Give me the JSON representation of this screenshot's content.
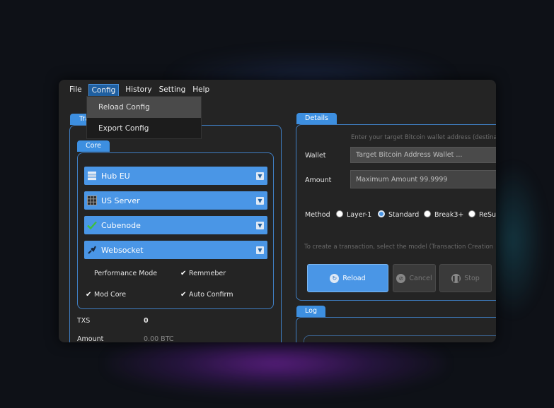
{
  "menubar": {
    "items": [
      "File",
      "Config",
      "History",
      "Setting",
      "Help"
    ],
    "active_index": 1
  },
  "config_menu": {
    "items": [
      "Reload Config",
      "Export Config"
    ],
    "hover_index": 0
  },
  "left_panel": {
    "tab_label": "Tra",
    "core": {
      "tab_label": "Core",
      "selects": [
        {
          "label": "Hub EU",
          "icon": "server-stack-icon"
        },
        {
          "label": "US Server",
          "icon": "server-grid-icon"
        },
        {
          "label": "Cubenode",
          "icon": "checkmark-icon"
        },
        {
          "label": "Websocket",
          "icon": "plug-icon"
        }
      ],
      "options": [
        {
          "label": "Performance Mode",
          "checked": false
        },
        {
          "label": "Remmeber",
          "checked": true
        },
        {
          "label": "Mod Core",
          "checked": true
        },
        {
          "label": "Auto Confirm",
          "checked": true
        }
      ]
    },
    "stats": {
      "txs_label": "TXS",
      "txs_value": "0",
      "amount_label": "Amount",
      "amount_value": "0.00 BTC"
    }
  },
  "details": {
    "tab_label": "Details",
    "hint": "Enter your target Bitcoin wallet address (destina",
    "wallet_label": "Wallet",
    "wallet_placeholder": "Target Bitcoin Address Wallet ...",
    "amount_label": "Amount",
    "amount_placeholder": "Maximum Amount 99.9999",
    "method_label": "Method",
    "methods": [
      "Layer-1",
      "Standard",
      "Break3+",
      "ReSub"
    ],
    "method_selected": 1,
    "instructions": "To create a transaction, select the model (Transaction Creation",
    "buttons": {
      "reload": "Reload",
      "cancel": "Cancel",
      "stop": "Stop"
    }
  },
  "log": {
    "tab_label": "Log"
  },
  "colors": {
    "accent": "#3d8fe0",
    "panel_border": "#3f7fc4",
    "window_bg": "#242424"
  }
}
